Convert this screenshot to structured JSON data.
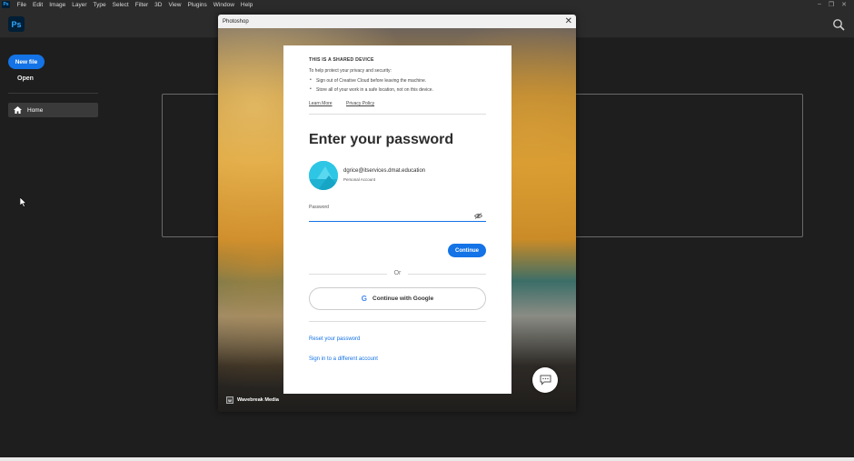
{
  "menubar": {
    "app_badge": "Ps",
    "items": [
      "File",
      "Edit",
      "Image",
      "Layer",
      "Type",
      "Select",
      "Filter",
      "3D",
      "View",
      "Plugins",
      "Window",
      "Help"
    ]
  },
  "header": {
    "logo": "Ps",
    "search_icon": "search-icon"
  },
  "sidebar": {
    "new_file": "New file",
    "open": "Open",
    "home": "Home"
  },
  "modal": {
    "title": "Photoshop",
    "close": "✕",
    "credit": "Wavebreak Media",
    "credit_logo": "W"
  },
  "card": {
    "shared_title": "THIS IS A SHARED DEVICE",
    "shared_desc": "To help protect your privacy and security:",
    "bullets": [
      "Sign out of Creative Cloud before leaving the machine.",
      "Store all of your work in a safe location, not on this device."
    ],
    "learn_more": "Learn More",
    "privacy_policy": "Privacy Policy",
    "heading": "Enter your password",
    "email": "dgrice@itservices.dmat.education",
    "account_type": "Personal Account",
    "password_label": "Password",
    "password_value": "",
    "continue": "Continue",
    "or": "Or",
    "google": "Continue with Google",
    "reset": "Reset your password",
    "different_account": "Sign in to a different account"
  },
  "colors": {
    "accent": "#1473e6",
    "avatar": "#2ec6e5",
    "ps_blue": "#31a8ff"
  }
}
